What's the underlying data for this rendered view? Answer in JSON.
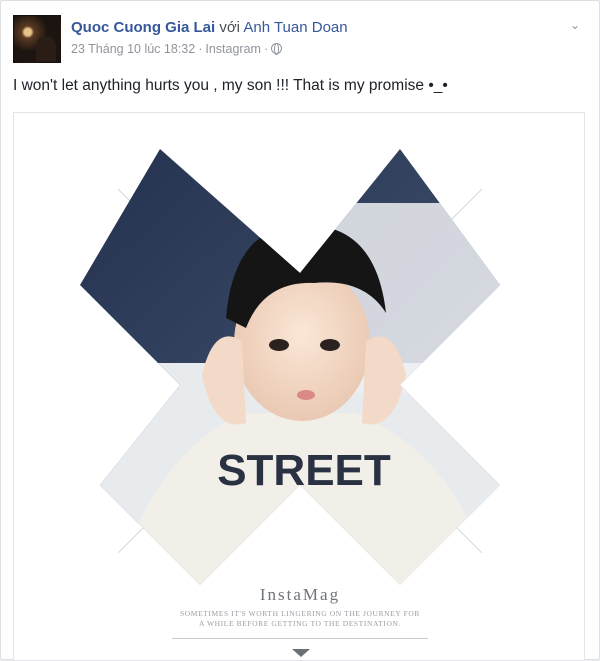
{
  "post": {
    "author": "Quoc Cuong Gia Lai",
    "with_word": "với",
    "tagged_person": "Anh Tuan Doan",
    "timestamp": "23 Tháng 10 lúc 18:32",
    "source": "Instagram",
    "separator": "·",
    "privacy_icon": "globe-icon",
    "menu_icon": "chevron-down-icon",
    "menu_glyph": "⌄",
    "message": "I won't let anything hurts you , my son !!! That is my promise •_•"
  },
  "photo": {
    "brand": "InstaMag",
    "tagline_line1": "Sometimes it's worth lingering on the journey for",
    "tagline_line2": "a while before getting to the destination."
  },
  "colors": {
    "link": "#365899",
    "meta": "#90949c",
    "text": "#1d2129"
  }
}
